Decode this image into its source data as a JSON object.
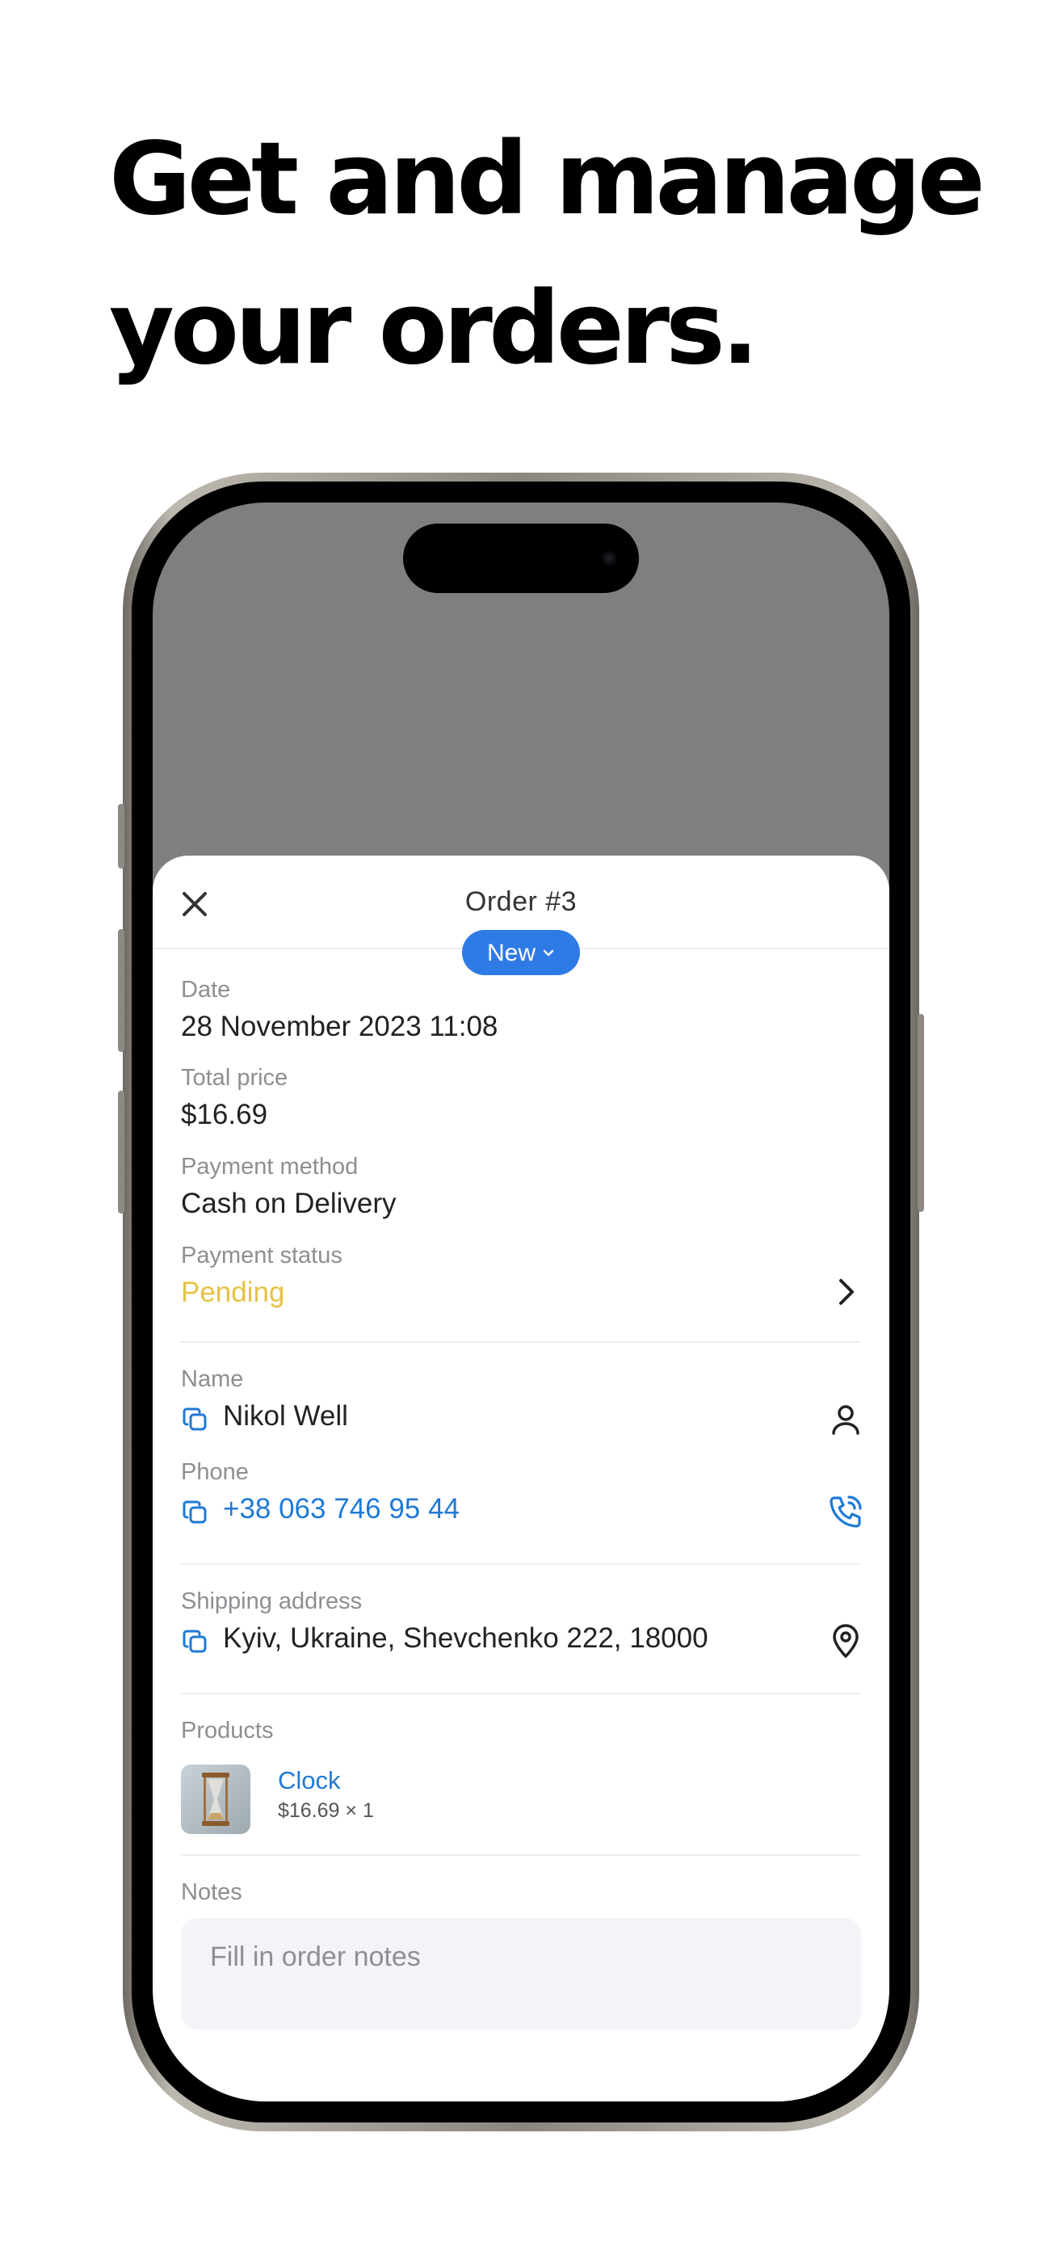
{
  "headline": {
    "line1": "Get and manage",
    "line2": "your orders."
  },
  "order": {
    "title": "Order #3",
    "status_label": "New",
    "fields": {
      "date_label": "Date",
      "date_value": "28 November 2023 11:08",
      "total_label": "Total price",
      "total_value": "$16.69",
      "payment_method_label": "Payment method",
      "payment_method_value": "Cash on Delivery",
      "payment_status_label": "Payment status",
      "payment_status_value": "Pending"
    },
    "customer": {
      "name_label": "Name",
      "name_value": "Nikol Well",
      "phone_label": "Phone",
      "phone_value": "+38 063 746 95 44"
    },
    "shipping": {
      "label": "Shipping address",
      "value": "Kyiv, Ukraine, Shevchenko 222, 18000"
    },
    "products": {
      "label": "Products",
      "items": [
        {
          "name": "Clock",
          "meta": "$16.69 × 1"
        }
      ]
    },
    "notes": {
      "label": "Notes",
      "placeholder": "Fill in order notes",
      "value": ""
    }
  },
  "icons": {
    "close": "close-icon",
    "chevron_down": "chevron-down-icon",
    "chevron_right": "chevron-right-icon",
    "copy": "copy-icon",
    "person": "person-icon",
    "phone": "phone-call-icon",
    "location": "location-pin-icon"
  },
  "colors": {
    "accent": "#2f7be6",
    "link": "#1f7ad6",
    "pending": "#e5c245",
    "label": "#8e8e93",
    "overlay": "#7f7f7f"
  }
}
